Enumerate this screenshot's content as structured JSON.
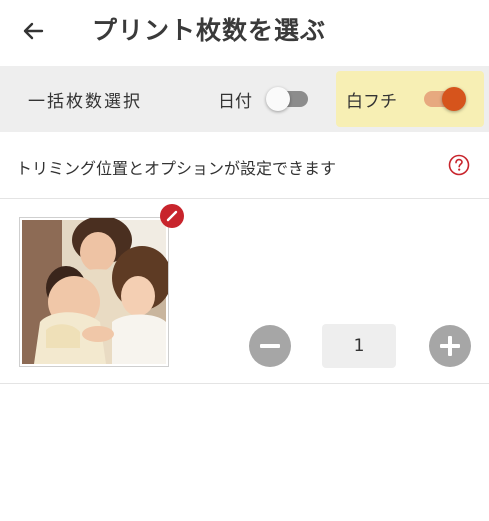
{
  "header": {
    "back_icon": "arrow-left-icon",
    "title": "プリント枚数を選ぶ"
  },
  "toolbar": {
    "bulk_select_label": "一括枚数選択",
    "date_label": "日付",
    "date_toggle_on": false,
    "border_label": "白フチ",
    "border_toggle_on": true,
    "highlight_color": "#f7efb4",
    "accent_color": "#d6541c"
  },
  "info": {
    "text": "トリミング位置とオプションが設定できます",
    "help_icon": "question-circle-icon",
    "help_icon_color": "#c8242c"
  },
  "photo_item": {
    "edit_icon": "pencil-icon",
    "quantity": "1",
    "minus_icon": "minus-circle-icon",
    "plus_icon": "plus-circle-icon"
  }
}
